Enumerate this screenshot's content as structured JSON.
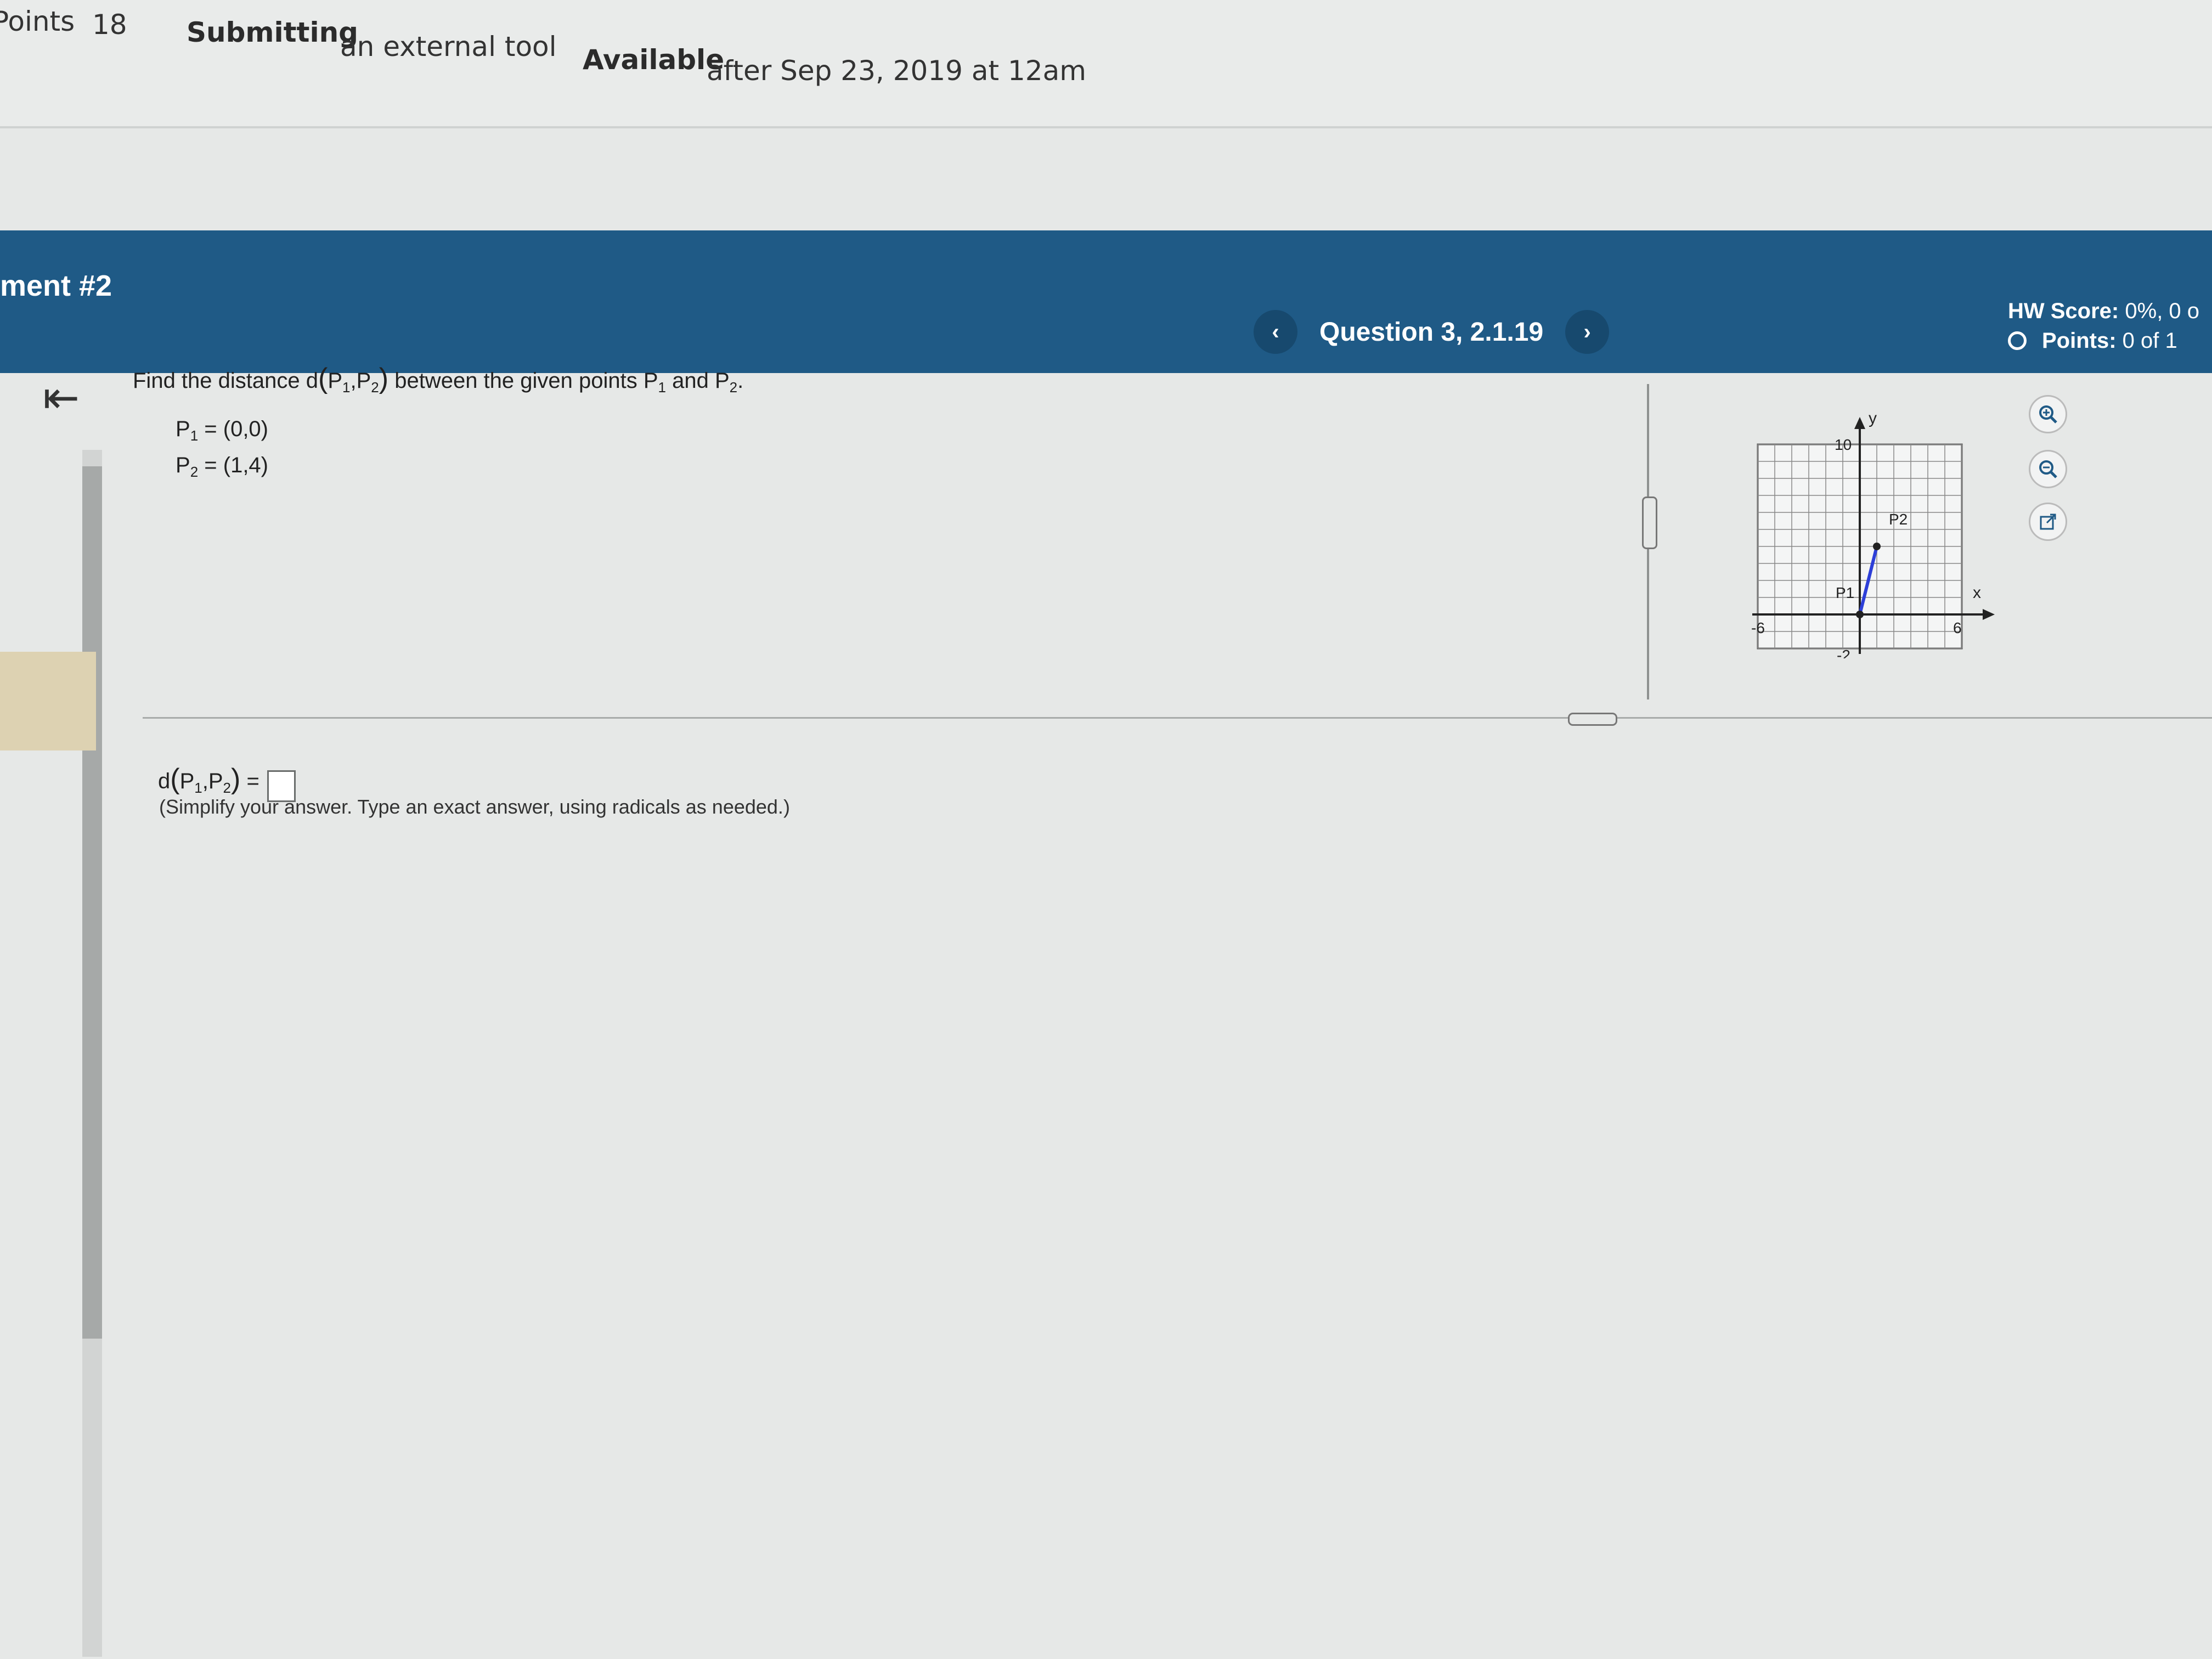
{
  "header": {
    "points_label": "Points",
    "points_value": "18",
    "submitting_label": "Submitting",
    "submitting_value": "an external tool",
    "available_label": "Available",
    "available_value": "after Sep 23, 2019 at 12am"
  },
  "banner": {
    "assignment_title": "ment #2",
    "question_title": "Question 3, 2.1.19",
    "prev": "‹",
    "next": "›",
    "hw_score_label": "HW Score:",
    "hw_score_value": "0%, 0 o",
    "points_label": "Points:",
    "points_value": "0 of 1"
  },
  "question": {
    "prompt_pre": "Find the distance d",
    "prompt_mid": "between the given points P",
    "prompt_and": "and P",
    "p1_value": "= (0,0)",
    "p2_value": "= (1,4)"
  },
  "answer": {
    "label_tail": "=",
    "hint": "(Simplify your answer. Type an exact answer, using radicals as needed.)"
  },
  "graph": {
    "y_axis_label": "y",
    "x_axis_label": "x",
    "y_max_label": "10",
    "y_min_label": "-2",
    "x_min_label": "-6",
    "x_max_label": "6",
    "p1_label": "P1",
    "p2_label": "P2",
    "points": [
      {
        "x": 0,
        "y": 0
      },
      {
        "x": 1,
        "y": 4
      }
    ],
    "segment_color": "#2d3fd8"
  },
  "tools": [
    "zoom-in-icon",
    "zoom-out-icon",
    "open-external-icon"
  ]
}
